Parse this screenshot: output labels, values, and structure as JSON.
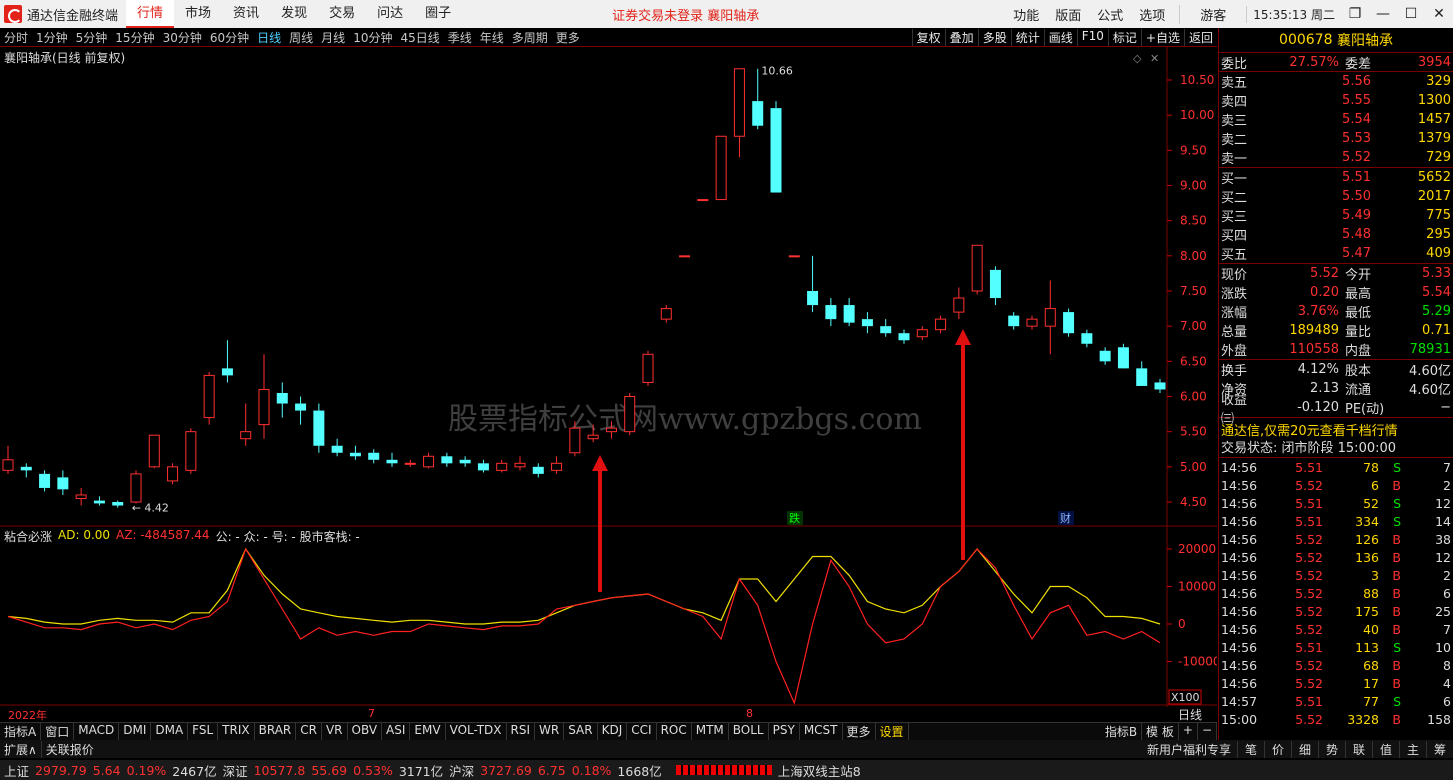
{
  "app": {
    "name": "通达信金融终端",
    "menus": [
      "行情",
      "市场",
      "资讯",
      "发现",
      "交易",
      "问达",
      "圈子"
    ],
    "active_menu": "行情",
    "notice": "证券交易未登录  襄阳轴承",
    "right_menus": [
      "功能",
      "版面",
      "公式",
      "选项"
    ],
    "guest": "游客",
    "clock": "15:35:13 周二"
  },
  "timeframes": [
    "分时",
    "1分钟",
    "5分钟",
    "15分钟",
    "30分钟",
    "60分钟",
    "日线",
    "周线",
    "月线",
    "10分钟",
    "45日线",
    "季线",
    "年线",
    "多周期",
    "更多"
  ],
  "active_tf": "日线",
  "tools": [
    "复权",
    "叠加",
    "多股",
    "统计",
    "画线",
    "F10",
    "标记",
    "+自选",
    "返回"
  ],
  "chart": {
    "title": "襄阳轴承(日线 前复权)",
    "high_label": "10.66",
    "low_label": "4.42",
    "fall_mark": "跌",
    "fin_mark": "财",
    "watermark": "股票指标公式网www.gpzbgs.com",
    "x_labels": [
      "2022年",
      "7",
      "8"
    ],
    "price_ticks": [
      "10.50",
      "10.00",
      "9.50",
      "9.00",
      "8.50",
      "8.00",
      "7.50",
      "7.00",
      "6.50",
      "6.00",
      "5.50",
      "5.00",
      "4.50"
    ],
    "ind_ticks": [
      "20000",
      "10000",
      "0",
      "-10000"
    ],
    "x100": "X100",
    "day_line": "日线"
  },
  "chart_data": {
    "type": "candlestick",
    "candles": [
      [
        4.95,
        5.1,
        5.3,
        4.9
      ],
      [
        5.0,
        4.95,
        5.05,
        4.85
      ],
      [
        4.9,
        4.7,
        4.95,
        4.65
      ],
      [
        4.85,
        4.68,
        4.95,
        4.6
      ],
      [
        4.55,
        4.6,
        4.7,
        4.45
      ],
      [
        4.52,
        4.48,
        4.58,
        4.45
      ],
      [
        4.5,
        4.45,
        4.52,
        4.42
      ],
      [
        4.5,
        4.9,
        4.95,
        4.48
      ],
      [
        5.0,
        5.45,
        5.45,
        4.98
      ],
      [
        4.8,
        5.0,
        5.05,
        4.75
      ],
      [
        4.95,
        5.5,
        5.55,
        4.9
      ],
      [
        5.7,
        6.3,
        6.35,
        5.6
      ],
      [
        6.4,
        6.3,
        6.8,
        6.2
      ],
      [
        5.4,
        5.5,
        5.9,
        5.3
      ],
      [
        5.6,
        6.1,
        6.6,
        5.4
      ],
      [
        6.05,
        5.9,
        6.2,
        5.7
      ],
      [
        5.9,
        5.8,
        6.0,
        5.6
      ],
      [
        5.8,
        5.3,
        5.9,
        5.2
      ],
      [
        5.3,
        5.2,
        5.4,
        5.15
      ],
      [
        5.2,
        5.15,
        5.3,
        5.1
      ],
      [
        5.2,
        5.1,
        5.25,
        5.05
      ],
      [
        5.1,
        5.05,
        5.2,
        5.0
      ],
      [
        5.05,
        5.05,
        5.1,
        5.0
      ],
      [
        5.0,
        5.15,
        5.2,
        4.98
      ],
      [
        5.15,
        5.05,
        5.2,
        5.0
      ],
      [
        5.1,
        5.05,
        5.15,
        5.0
      ],
      [
        5.05,
        4.95,
        5.1,
        4.92
      ],
      [
        4.95,
        5.05,
        5.1,
        4.92
      ],
      [
        5.0,
        5.05,
        5.15,
        4.95
      ],
      [
        5.0,
        4.9,
        5.05,
        4.85
      ],
      [
        4.95,
        5.05,
        5.15,
        4.9
      ],
      [
        5.2,
        5.55,
        5.65,
        5.15
      ],
      [
        5.4,
        5.45,
        5.6,
        5.35
      ],
      [
        5.5,
        5.55,
        5.65,
        5.4
      ],
      [
        5.5,
        6.0,
        6.05,
        5.45
      ],
      [
        6.2,
        6.6,
        6.65,
        6.15
      ],
      [
        7.1,
        7.25,
        7.3,
        7.05
      ],
      [
        8.0,
        8.0,
        8.0,
        8.0
      ],
      [
        8.8,
        8.8,
        8.8,
        8.8
      ],
      [
        8.8,
        9.7,
        9.7,
        8.8
      ],
      [
        9.7,
        10.66,
        10.66,
        9.4
      ],
      [
        10.2,
        9.85,
        10.66,
        9.8
      ],
      [
        10.1,
        8.9,
        10.2,
        8.9
      ],
      [
        8.0,
        8.0,
        8.0,
        8.0
      ],
      [
        7.5,
        7.3,
        8.0,
        7.2
      ],
      [
        7.3,
        7.1,
        7.4,
        7.0
      ],
      [
        7.3,
        7.05,
        7.4,
        7.0
      ],
      [
        7.1,
        7.0,
        7.2,
        6.9
      ],
      [
        7.0,
        6.9,
        7.1,
        6.85
      ],
      [
        6.9,
        6.8,
        6.95,
        6.75
      ],
      [
        6.85,
        6.95,
        7.0,
        6.8
      ],
      [
        6.95,
        7.1,
        7.15,
        6.9
      ],
      [
        7.2,
        7.4,
        7.55,
        7.1
      ],
      [
        7.5,
        8.15,
        8.15,
        7.45
      ],
      [
        7.8,
        7.4,
        7.85,
        7.3
      ],
      [
        7.15,
        7.0,
        7.2,
        6.95
      ],
      [
        7.0,
        7.1,
        7.15,
        6.95
      ],
      [
        7.0,
        7.25,
        7.65,
        6.6
      ],
      [
        7.2,
        6.9,
        7.25,
        6.85
      ],
      [
        6.9,
        6.75,
        6.95,
        6.7
      ],
      [
        6.65,
        6.5,
        6.7,
        6.45
      ],
      [
        6.7,
        6.4,
        6.75,
        6.4
      ],
      [
        6.4,
        6.15,
        6.5,
        6.15
      ],
      [
        6.2,
        6.1,
        6.25,
        6.05
      ]
    ],
    "ind_yellow": [
      2000,
      1500,
      500,
      0,
      0,
      1000,
      1500,
      1000,
      1000,
      500,
      3000,
      3000,
      9000,
      20000,
      13000,
      8000,
      4000,
      3000,
      2000,
      1500,
      1000,
      500,
      1000,
      1000,
      500,
      0,
      0,
      500,
      500,
      1000,
      3000,
      5000,
      6000,
      7000,
      7500,
      8000,
      6000,
      4000,
      3000,
      1000,
      12000,
      12000,
      6000,
      12000,
      18000,
      18000,
      13000,
      6000,
      4000,
      3000,
      5000,
      10000,
      14000,
      20000,
      14000,
      8000,
      3000,
      10000,
      10000,
      7000,
      2000,
      2000,
      1500,
      0
    ],
    "ind_red": [
      2000,
      500,
      -1000,
      -1000,
      -1500,
      0,
      500,
      -1000,
      0,
      -1500,
      1000,
      2000,
      6000,
      20000,
      12000,
      4000,
      -4000,
      -1000,
      -3000,
      -2000,
      -3000,
      -2000,
      -2000,
      0,
      -500,
      -1000,
      -1500,
      -500,
      -500,
      0,
      4000,
      5000,
      6000,
      7000,
      7500,
      8000,
      6000,
      4000,
      2000,
      -4000,
      12000,
      5000,
      -10000,
      -30000,
      0,
      17000,
      10000,
      0,
      -5000,
      -4000,
      0,
      10000,
      14000,
      20000,
      15000,
      5000,
      -4000,
      3000,
      5000,
      -3000,
      -2000,
      -4000,
      -2000,
      -5000
    ]
  },
  "indicator": {
    "name": "粘合必涨",
    "ad": "AD: 0.00",
    "az": "AZ: -484587.44",
    "other": "公: -  众: -  号: -  股市客栈: -"
  },
  "quote": {
    "code": "000678",
    "name": "襄阳轴承",
    "weibi_label": "委比",
    "weibi": "27.57%",
    "weicha_label": "委差",
    "weicha": "3954",
    "sells": [
      {
        "label": "卖五",
        "price": "5.56",
        "vol": "329"
      },
      {
        "label": "卖四",
        "price": "5.55",
        "vol": "1300"
      },
      {
        "label": "卖三",
        "price": "5.54",
        "vol": "1457"
      },
      {
        "label": "卖二",
        "price": "5.53",
        "vol": "1379"
      },
      {
        "label": "卖一",
        "price": "5.52",
        "vol": "729"
      }
    ],
    "buys": [
      {
        "label": "买一",
        "price": "5.51",
        "vol": "5652"
      },
      {
        "label": "买二",
        "price": "5.50",
        "vol": "2017"
      },
      {
        "label": "买三",
        "price": "5.49",
        "vol": "775"
      },
      {
        "label": "买四",
        "price": "5.48",
        "vol": "295"
      },
      {
        "label": "买五",
        "price": "5.47",
        "vol": "409"
      }
    ],
    "stats1": [
      [
        "现价",
        "5.52",
        "今开",
        "5.33",
        "red",
        "red"
      ],
      [
        "涨跌",
        "0.20",
        "最高",
        "5.54",
        "red",
        "red"
      ],
      [
        "涨幅",
        "3.76%",
        "最低",
        "5.29",
        "red",
        "grn"
      ],
      [
        "总量",
        "189489",
        "量比",
        "0.71",
        "yel",
        "yel"
      ],
      [
        "外盘",
        "110558",
        "内盘",
        "78931",
        "red",
        "grn"
      ]
    ],
    "stats2": [
      [
        "换手",
        "4.12%",
        "股本",
        "4.60亿",
        "wht",
        "wht"
      ],
      [
        "净资",
        "2.13",
        "流通",
        "4.60亿",
        "wht",
        "wht"
      ],
      [
        "收益㈢",
        "-0.120",
        "PE(动)",
        "−",
        "wht",
        "wht"
      ]
    ],
    "promo": "通达信,仅需20元查看千档行情",
    "trade_status": "交易状态: 闭市阶段 15:00:00",
    "ticks": [
      [
        "14:56",
        "5.51",
        "78",
        "S",
        "7"
      ],
      [
        "14:56",
        "5.52",
        "6",
        "B",
        "2"
      ],
      [
        "14:56",
        "5.51",
        "52",
        "S",
        "12"
      ],
      [
        "14:56",
        "5.51",
        "334",
        "S",
        "14"
      ],
      [
        "14:56",
        "5.52",
        "126",
        "B",
        "38"
      ],
      [
        "14:56",
        "5.52",
        "136",
        "B",
        "12"
      ],
      [
        "14:56",
        "5.52",
        "3",
        "B",
        "2"
      ],
      [
        "14:56",
        "5.52",
        "88",
        "B",
        "6"
      ],
      [
        "14:56",
        "5.52",
        "175",
        "B",
        "25"
      ],
      [
        "14:56",
        "5.52",
        "40",
        "B",
        "7"
      ],
      [
        "14:56",
        "5.51",
        "113",
        "S",
        "10"
      ],
      [
        "14:56",
        "5.52",
        "68",
        "B",
        "8"
      ],
      [
        "14:56",
        "5.52",
        "17",
        "B",
        "4"
      ],
      [
        "14:57",
        "5.51",
        "77",
        "S",
        "6"
      ],
      [
        "15:00",
        "5.52",
        "3328",
        "B",
        "158"
      ]
    ]
  },
  "tabs": [
    "指标A",
    "窗口",
    "MACD",
    "DMI",
    "DMA",
    "FSL",
    "TRIX",
    "BRAR",
    "CR",
    "VR",
    "OBV",
    "ASI",
    "EMV",
    "VOL-TDX",
    "RSI",
    "WR",
    "SAR",
    "KDJ",
    "CCI",
    "ROC",
    "MTM",
    "BOLL",
    "PSY",
    "MCST",
    "更多",
    "设置"
  ],
  "tabs_right": [
    "指标B",
    "模 板",
    "+",
    "−"
  ],
  "bottom": {
    "left1": "扩展∧",
    "left2": "关联报价",
    "right": "新用户福利专享",
    "rtabs": [
      "笔",
      "价",
      "细",
      "势",
      "联",
      "值",
      "主",
      "筹"
    ]
  },
  "status": {
    "sh_label": "上证",
    "sh": "2979.79",
    "sh_chg": "5.64",
    "sh_pct": "0.19%",
    "sh_amt": "2467亿",
    "sz_label": "深证",
    "sz": "10577.8",
    "sz_chg": "55.69",
    "sz_pct": "0.53%",
    "sz_amt": "3171亿",
    "hs_label": "沪深",
    "hs": "3727.69",
    "hs_chg": "6.75",
    "hs_pct": "0.18%",
    "hs_amt": "1668亿",
    "server": "上海双线主站8"
  }
}
